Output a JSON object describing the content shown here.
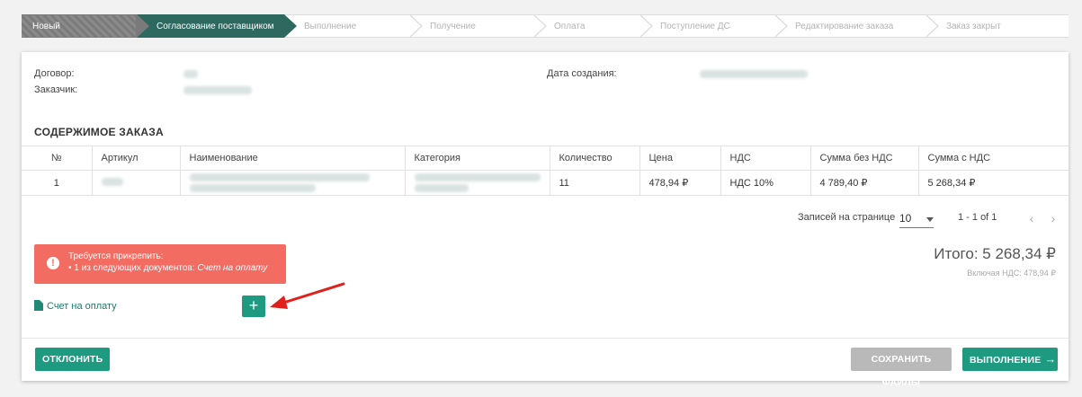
{
  "stepper": {
    "steps": [
      {
        "label": "Новый",
        "state": "done"
      },
      {
        "label": "Согласование поставщиком",
        "state": "active"
      },
      {
        "label": "Выполнение",
        "state": "pending"
      },
      {
        "label": "Получение",
        "state": "pending"
      },
      {
        "label": "Оплата",
        "state": "pending"
      },
      {
        "label": "Поступление ДС",
        "state": "pending"
      },
      {
        "label": "Редактирование заказа",
        "state": "pending"
      },
      {
        "label": "Заказ закрыт",
        "state": "pending"
      }
    ]
  },
  "meta": {
    "contract_label": "Договор:",
    "customer_label": "Заказчик:",
    "created_label": "Дата создания:"
  },
  "order": {
    "section_title": "СОДЕРЖИМОЕ ЗАКАЗА",
    "columns": [
      "№",
      "Артикул",
      "Наименование",
      "Категория",
      "Количество",
      "Цена",
      "НДС",
      "Сумма без НДС",
      "Сумма с НДС"
    ],
    "rows": [
      {
        "num": "1",
        "qty": "11",
        "price": "478,94 ₽",
        "vat": "НДС 10%",
        "sum_no_vat": "4 789,40 ₽",
        "sum_vat": "5 268,34 ₽"
      }
    ]
  },
  "pagination": {
    "per_page_label": "Записей на странице",
    "per_page_value": "10",
    "range": "1 - 1 of 1",
    "prev": "‹",
    "next": "›"
  },
  "totals": {
    "total": "Итого: 5 268,34 ₽",
    "vat_note": "Включая НДС: 478,94 ₽"
  },
  "alert": {
    "title": "Требуется прикрепить:",
    "line_prefix": "•  1 из следующих документов:",
    "line_doc": "Счет на оплату"
  },
  "documents": {
    "invoice_label": "Счет на оплату",
    "add_label": "+"
  },
  "actions": {
    "reject": "ОТКЛОНИТЬ",
    "save_files": "СОХРАНИТЬ ФАЙЛЫ",
    "execute": "ВЫПОЛНЕНИЕ",
    "execute_arrow": "→"
  },
  "colors": {
    "accent": "#1e9a80",
    "active_step": "#2e6960",
    "alert": "#f36c61",
    "disabled": "#b9b9b9"
  }
}
